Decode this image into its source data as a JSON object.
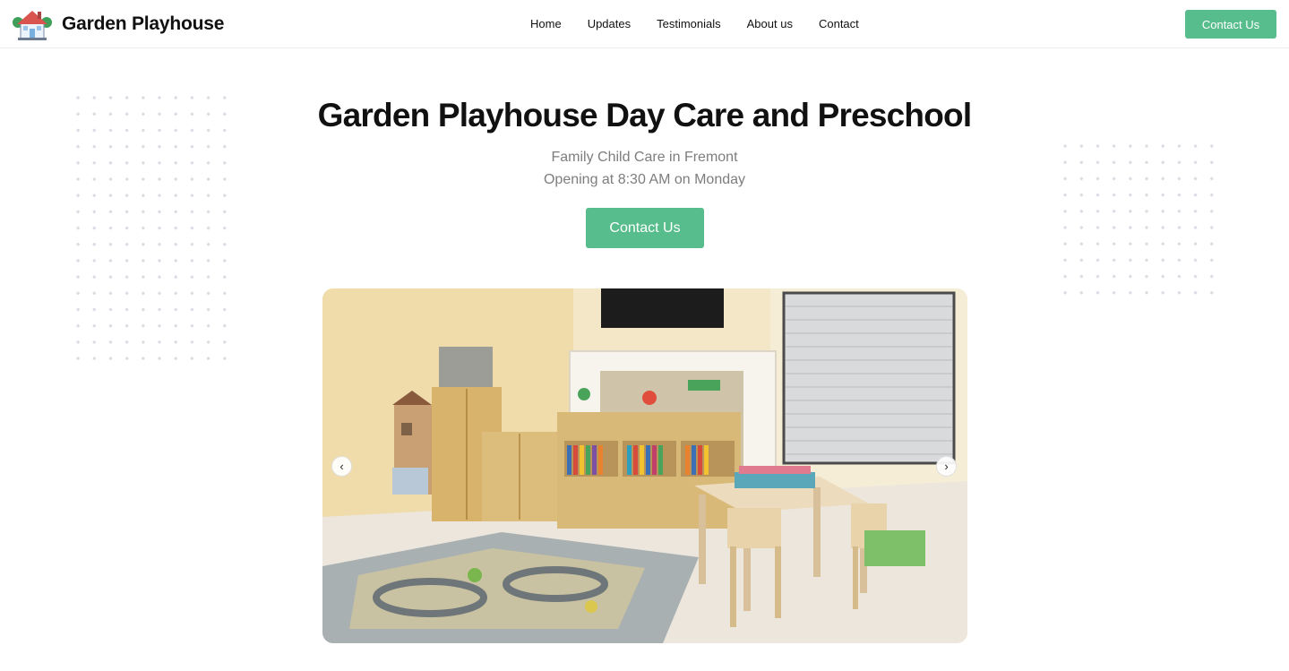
{
  "header": {
    "brand_name": "Garden Playhouse",
    "logo_icon": "house-icon",
    "nav": [
      "Home",
      "Updates",
      "Testimonials",
      "About us",
      "Contact"
    ],
    "cta_label": "Contact Us"
  },
  "hero": {
    "title": "Garden Playhouse Day Care and Preschool",
    "subtitle_1": "Family Child Care in Fremont",
    "subtitle_2": "Opening at 8:30 AM on Monday",
    "cta_label": "Contact Us"
  },
  "carousel": {
    "prev_icon": "chevron-left-icon",
    "next_icon": "chevron-right-icon",
    "prev_glyph": "‹",
    "next_glyph": "›"
  },
  "colors": {
    "accent": "#58bd8c",
    "subtitle": "#7d7d7d",
    "dots": "#d9dde3"
  }
}
